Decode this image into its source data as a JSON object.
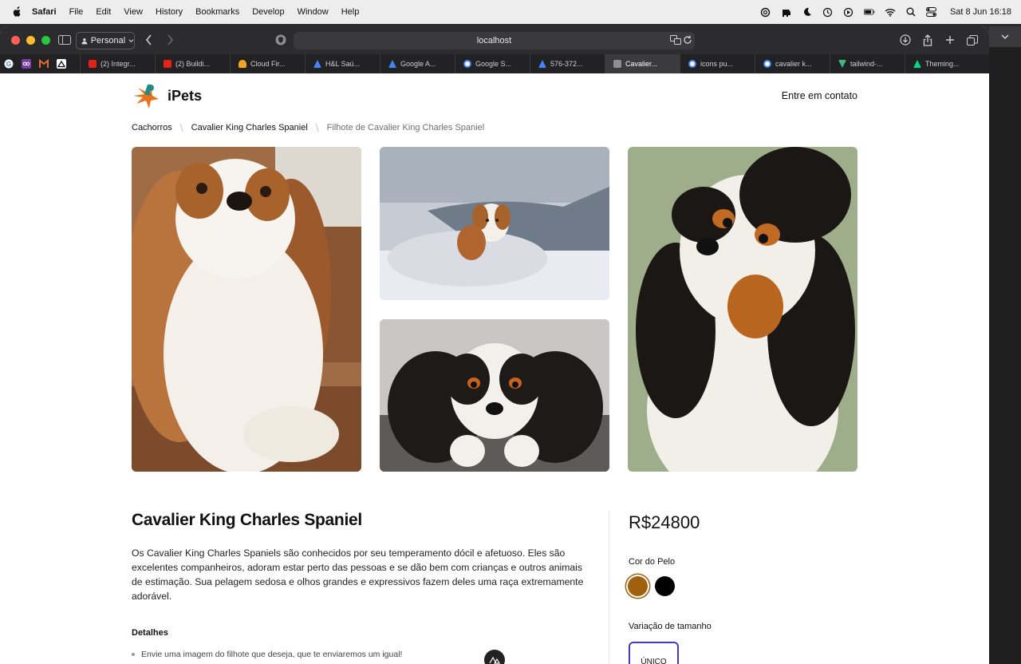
{
  "menubar": {
    "app": "Safari",
    "items": [
      "File",
      "Edit",
      "View",
      "History",
      "Bookmarks",
      "Develop",
      "Window",
      "Help"
    ],
    "clock": "Sat 8 Jun  16:18"
  },
  "browser": {
    "profile": "Personal",
    "url": "localhost",
    "tabs": [
      {
        "label": "(2) Integr...",
        "icon": "youtube-icon",
        "color": "#e62117"
      },
      {
        "label": "(2) Buildi...",
        "icon": "youtube-icon",
        "color": "#e62117"
      },
      {
        "label": "Cloud Fir...",
        "icon": "firebase-icon",
        "color": "#f5a623"
      },
      {
        "label": "H&L Saú...",
        "icon": "google-ads-icon",
        "color": "#4285f4"
      },
      {
        "label": "Google A...",
        "icon": "google-ads-icon",
        "color": "#4285f4"
      },
      {
        "label": "Google S...",
        "icon": "google-icon",
        "color": "#4285f4"
      },
      {
        "label": "576-372...",
        "icon": "google-ads-icon",
        "color": "#4285f4"
      },
      {
        "label": "Cavalier...",
        "icon": "letter-l-icon",
        "color": "#8e8e93",
        "active": true
      },
      {
        "label": "icons pu...",
        "icon": "google-icon",
        "color": "#4285f4"
      },
      {
        "label": "cavalier k...",
        "icon": "google-icon",
        "color": "#4285f4"
      },
      {
        "label": "tailwind-...",
        "icon": "vue-icon",
        "color": "#41b883"
      },
      {
        "label": "Theming...",
        "icon": "nuxt-icon",
        "color": "#00dc82"
      }
    ]
  },
  "site": {
    "brand": "iPets",
    "contact": "Entre em contato"
  },
  "breadcrumb": {
    "items": [
      "Cachorros",
      "Cavalier King Charles Spaniel"
    ],
    "current": "Filhote de Cavalier King Charles Spaniel"
  },
  "product": {
    "title": "Cavalier King Charles Spaniel",
    "description": "Os Cavalier King Charles Spaniels são conhecidos por seu temperamento dócil e afetuoso. Eles são excelentes companheiros, adoram estar perto das pessoas e se dão bem com crianças e outros animais de estimação. Sua pelagem sedosa e olhos grandes e expressivos fazem deles uma raça extremamente adorável.",
    "details_heading": "Detalhes",
    "details": [
      "Envie uma imagem do filhote que deseja, que te enviaremos um igual!"
    ],
    "price": "R$24800",
    "color_label": "Cor do Pelo",
    "colors": [
      "#a0600e",
      "#000000"
    ],
    "size_label": "Variação de tamanho",
    "sizes": [
      "ÚNICO"
    ]
  }
}
